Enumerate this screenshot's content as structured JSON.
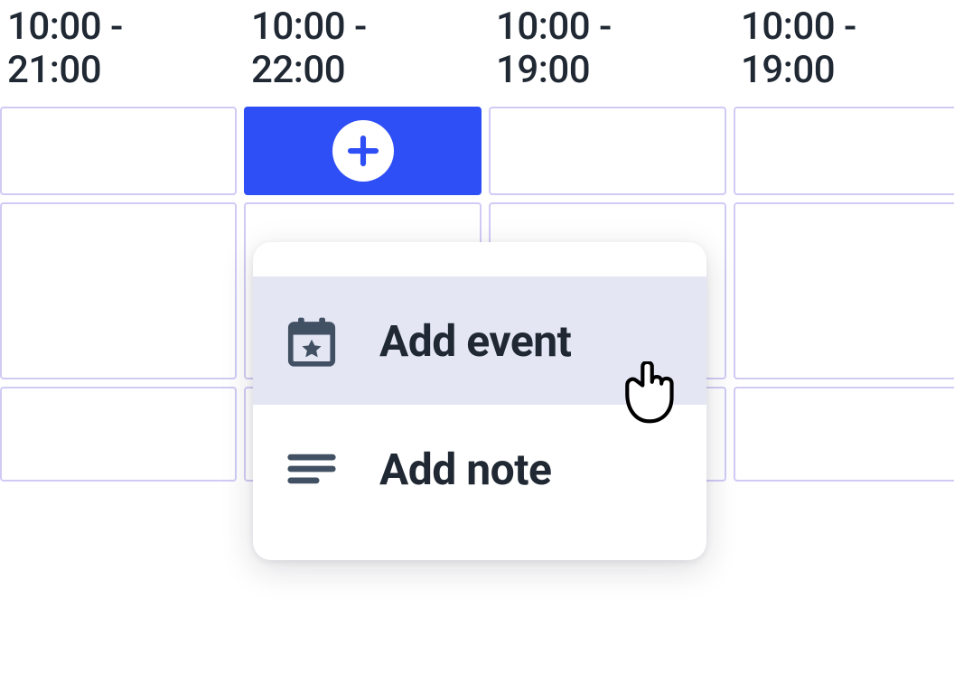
{
  "header": {
    "columns": [
      {
        "start": "10:00",
        "end": "21:00"
      },
      {
        "start": "10:00",
        "end": "22:00"
      },
      {
        "start": "10:00",
        "end": "19:00"
      },
      {
        "start": "10:00",
        "end": "19:00"
      }
    ]
  },
  "popover": {
    "items": [
      {
        "label": "Add event"
      },
      {
        "label": "Add note"
      }
    ]
  }
}
